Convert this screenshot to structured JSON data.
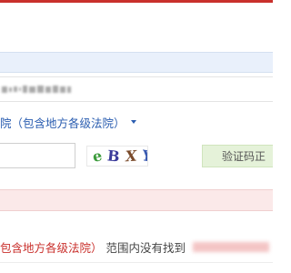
{
  "search_form": {
    "court_selector": {
      "label": "院（包含地方各级法院）"
    },
    "captcha": {
      "input_value": "",
      "chars": [
        "e",
        "B",
        "X",
        "Y"
      ],
      "button_label": "验证码正"
    }
  },
  "result_message": {
    "court_scope": "包含地方各级法院）",
    "text": "范围内没有找到",
    "surname": "王"
  },
  "colors": {
    "accent_red": "#c9302c",
    "link_blue": "#2a5db0",
    "info_strip": "#e9f0fb",
    "alert_strip": "#fbe9e9",
    "verify_button": "#e5f2d9"
  }
}
